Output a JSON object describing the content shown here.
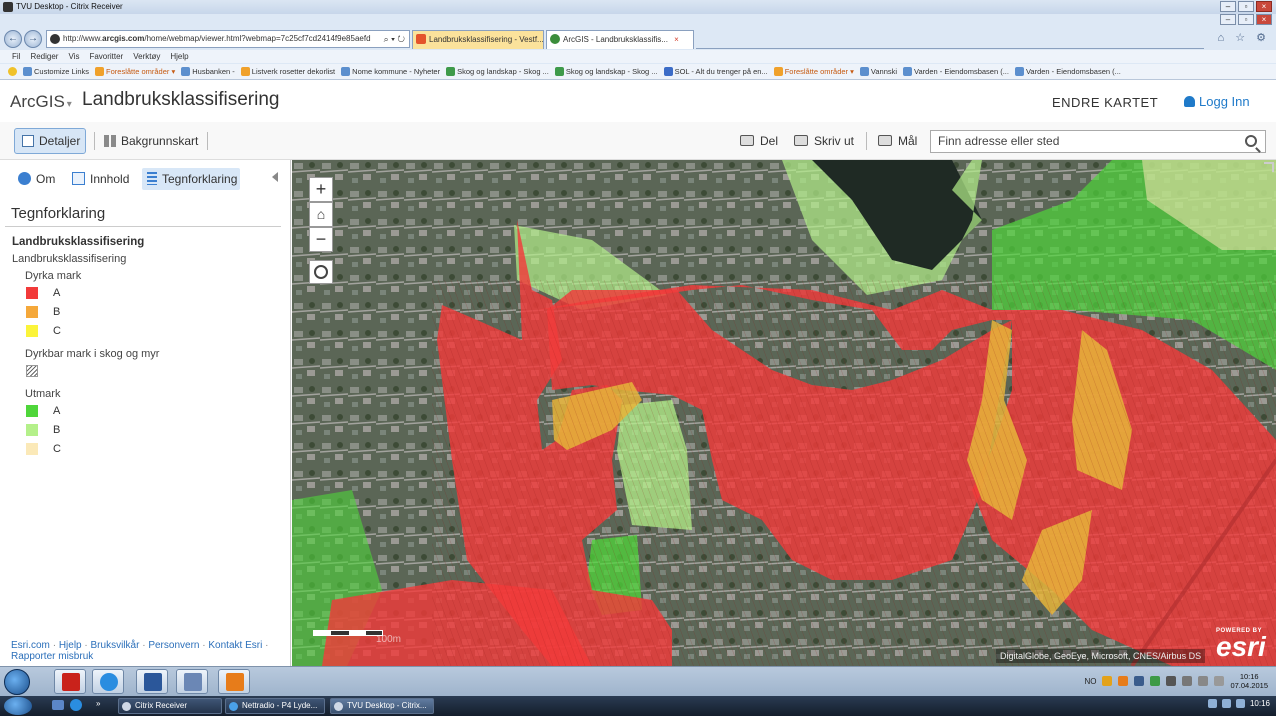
{
  "citrix": {
    "title": "TVU Desktop - Citrix Receiver"
  },
  "browser": {
    "url_prefix": "http://www.",
    "url_domain": "arcgis.com",
    "url_rest": "/home/webmap/viewer.html?webmap=7c25cf7cd2414f9e85aefd",
    "url_icons": "⌕ ▾ ↻",
    "tabs": [
      {
        "label": "Landbruksklassifisering - Vestf..."
      },
      {
        "label": "ArcGIS - Landbruksklassifis...",
        "close": "×"
      }
    ],
    "right_icons": "⌂ ☆ ⚙",
    "menu": [
      "Fil",
      "Rediger",
      "Vis",
      "Favoritter",
      "Verktøy",
      "Hjelp"
    ],
    "favorites": [
      "Customize Links",
      "Foreslåtte områder ▾",
      "Husbanken -",
      "Listverk rosetter dekorlist",
      "Nome kommune - Nyheter",
      "Skog og landskap - Skog ...",
      "Skog og landskap - Skog ...",
      "SOL - Alt du trenger på en...",
      "Foreslåtte områder ▾",
      "Vannski",
      "Varden - Eiendomsbasen (...",
      "Varden - Eiendomsbasen (..."
    ],
    "favorites_more": "»"
  },
  "header": {
    "brand": "ArcGIS",
    "brand_caret": "▾",
    "title": "Landbruksklassifisering",
    "edit_map": "ENDRE KARTET",
    "login": "Logg Inn"
  },
  "toolbar": {
    "details": "Detaljer",
    "basemap": "Bakgrunnskart",
    "share": "Del",
    "print": "Skriv ut",
    "measure": "Mål",
    "search_placeholder": "Finn adresse eller sted"
  },
  "panel": {
    "tabs": {
      "about": "Om",
      "content": "Innhold",
      "legend": "Tegnforklaring"
    },
    "title": "Tegnforklaring",
    "layer": "Landbruksklassifisering",
    "sublayer": "Landbruksklassifisering",
    "groups": [
      {
        "name": "Dyrka mark",
        "items": [
          {
            "label": "A",
            "color": "#f23a3a"
          },
          {
            "label": "B",
            "color": "#f5a83a"
          },
          {
            "label": "C",
            "color": "#fbf43a"
          }
        ]
      },
      {
        "name": "Dyrkbar mark i skog og myr",
        "items": [
          {
            "label": "",
            "color": "hatch"
          }
        ]
      },
      {
        "name": "Utmark",
        "items": [
          {
            "label": "A",
            "color": "#4fd63a"
          },
          {
            "label": "B",
            "color": "#b4f08a"
          },
          {
            "label": "C",
            "color": "#fbe9b8"
          }
        ]
      }
    ],
    "footer": {
      "links": [
        "Esri.com",
        "Hjelp",
        "Bruksvilkår",
        "Personvern",
        "Kontakt Esri"
      ],
      "report": "Rapporter misbruk",
      "separator": "·"
    }
  },
  "map": {
    "zoom_in": "+",
    "home": "⌂",
    "zoom_out": "−",
    "scale_label": "100m",
    "attribution": "DigitalGlobe, GeoEye, Microsoft, CNES/Airbus DS",
    "powered_by": "POWERED BY",
    "esri": "esri"
  },
  "taskbar": {
    "lang": "NO",
    "time": "10:16",
    "date": "07.04.2015",
    "windows": [
      "Citrix Receiver",
      "Nettradio - P4 Lyde...",
      "TVU Desktop - Citrix..."
    ],
    "more": "»",
    "bottom_time": "10:16"
  },
  "colors": {
    "accent": "#1f7ac9",
    "dyrka_a": "#f23a3a",
    "dyrka_c": "#fbf43a",
    "utmark_a": "#4fd63a",
    "utmark_b": "#b4f08a"
  }
}
